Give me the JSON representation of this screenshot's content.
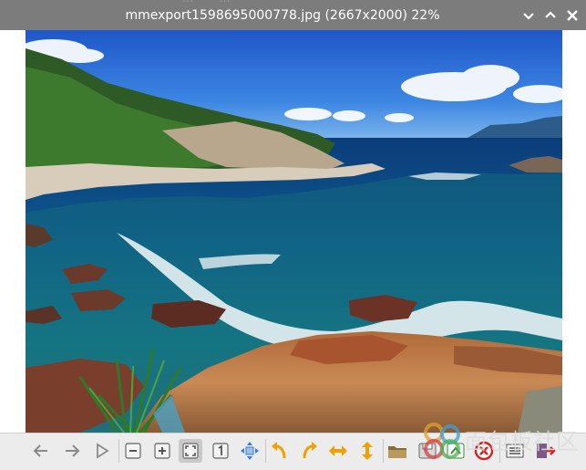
{
  "window": {
    "title": "mmexport1598695000778.jpg (2667x2000) 22%",
    "background_titles": [
      "...",
      "..."
    ],
    "controls": {
      "minimize": "chevron-down-icon",
      "maximize": "chevron-up-icon",
      "close": "close-icon"
    }
  },
  "toolbar": {
    "buttons": [
      {
        "name": "previous-button",
        "icon": "arrow-left-icon"
      },
      {
        "name": "next-button",
        "icon": "arrow-right-icon"
      },
      {
        "name": "slideshow-button",
        "icon": "play-icon"
      },
      {
        "name": "zoom-out-button",
        "icon": "zoom-out-icon"
      },
      {
        "name": "zoom-in-button",
        "icon": "zoom-in-icon"
      },
      {
        "name": "fit-window-button",
        "icon": "fit-icon",
        "active": true
      },
      {
        "name": "original-size-button",
        "icon": "one-to-one-icon"
      },
      {
        "name": "fullscreen-button",
        "icon": "fullscreen-icon"
      },
      {
        "name": "rotate-left-button",
        "icon": "rotate-left-icon"
      },
      {
        "name": "rotate-right-button",
        "icon": "rotate-right-icon"
      },
      {
        "name": "flip-horizontal-button",
        "icon": "flip-horizontal-icon"
      },
      {
        "name": "flip-vertical-button",
        "icon": "flip-vertical-icon"
      },
      {
        "name": "open-file-button",
        "icon": "folder-icon"
      },
      {
        "name": "save-button",
        "icon": "save-icon"
      },
      {
        "name": "delete-button",
        "icon": "delete-icon"
      },
      {
        "name": "preferences-button",
        "icon": "menu-icon"
      },
      {
        "name": "quit-button",
        "icon": "exit-icon"
      }
    ]
  },
  "watermark": {
    "text": "面包板社区"
  },
  "colors": {
    "titlebar": "#7c7c7c",
    "toolbar": "#ececec",
    "arrow_orange": "#f0a000",
    "delete_red": "#d92020"
  }
}
